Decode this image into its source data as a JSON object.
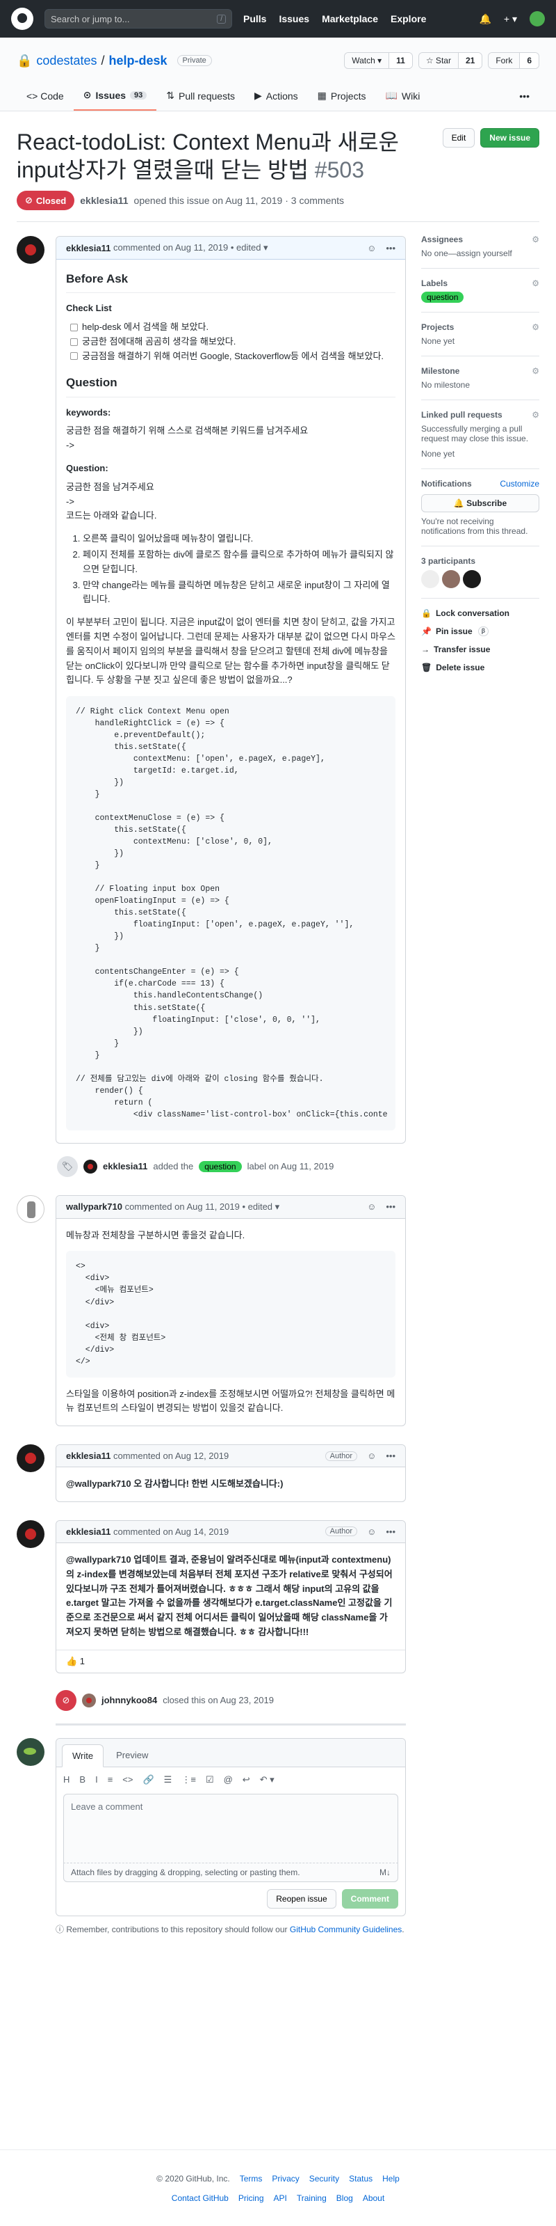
{
  "header": {
    "search_placeholder": "Search or jump to...",
    "slash": "/",
    "nav": [
      "Pulls",
      "Issues",
      "Marketplace",
      "Explore"
    ],
    "plus": "+ ▾"
  },
  "repo": {
    "owner": "codestates",
    "separator": "/",
    "name": "help-desk",
    "visibility": "Private",
    "watch": {
      "label": "Watch ▾",
      "count": "11"
    },
    "star": {
      "label": "☆ Star",
      "count": "21"
    },
    "fork": {
      "label": "Fork",
      "count": "6"
    },
    "tabs": [
      {
        "label": "<> Code"
      },
      {
        "label": "Issues",
        "count": "93"
      },
      {
        "label": "Pull requests"
      },
      {
        "label": "Actions"
      },
      {
        "label": "Projects"
      },
      {
        "label": "Wiki"
      }
    ],
    "more": "•••"
  },
  "issue": {
    "title": "React-todoList: Context Menu과 새로운 input상자가 열렸을때 닫는 방법",
    "number": "#503",
    "edit_label": "Edit",
    "new_issue_label": "New issue",
    "state": "Closed",
    "author": "ekklesia11",
    "meta": "opened this issue on Aug 11, 2019 · 3 comments"
  },
  "comment1": {
    "author": "ekklesia11",
    "meta": "commented on Aug 11, 2019 • edited ▾",
    "h_before": "Before Ask",
    "h_check": "Check List",
    "checks": [
      "help-desk 에서 검색을 해 보았다.",
      "궁금한 점에대해 곰곰히 생각을 해보았다.",
      "궁금점을 해결하기 위해 여러번 Google, Stackoverflow등 에서 검색을 해보았다."
    ],
    "h_question": "Question",
    "h_keywords": "keywords:",
    "kw_text": "궁금한 점을 해결하기 위해 스스로 검색해본 키워드를 남겨주세요",
    "arrow": "->",
    "h_q2": "Question:",
    "q_text1": "궁금한 점을 남겨주세요",
    "q_text2": "코드는 아래와 같습니다.",
    "steps": [
      "오른쪽 클릭이 일어났을때 메뉴창이 열립니다.",
      "페이지 전체를 포함하는 div에 클로즈 함수를 클릭으로 추가하여 메뉴가 클릭되지 않으면 닫힙니다.",
      "만약 change라는 메뉴를 클릭하면 메뉴창은 닫히고 새로운 input창이 그 자리에 열립니다."
    ],
    "para": "이 부분부터 고민이 됩니다. 지금은 input값이 없이 엔터를 치면 창이 닫히고, 값을 가지고 엔터를 치면 수정이 일어납니다. 그런데 문제는 사용자가 대부분 값이 없으면 다시 마우스를 움직이서 페이지 임의의 부분을 클릭해서 창을 닫으려고 할텐데 전체 div에 메뉴창을 닫는 onClick이 있다보니까 만약 클릭으로 닫는 함수를 추가하면 input창을 클릭해도 닫힙니다. 두 상황을 구분 짓고 싶은데 좋은 방법이 없을까요...?",
    "code": "// Right click Context Menu open\n    handleRightClick = (e) => {\n        e.preventDefault();\n        this.setState({\n            contextMenu: ['open', e.pageX, e.pageY],\n            targetId: e.target.id,\n        })\n    }\n\n    contextMenuClose = (e) => {\n        this.setState({\n            contextMenu: ['close', 0, 0],\n        })\n    }\n\n    // Floating input box Open\n    openFloatingInput = (e) => {\n        this.setState({\n            floatingInput: ['open', e.pageX, e.pageY, ''],\n        })\n    }\n\n    contentsChangeEnter = (e) => {\n        if(e.charCode === 13) {\n            this.handleContentsChange()\n            this.setState({\n                floatingInput: ['close', 0, 0, ''],\n            })\n        }\n    }\n\n// 전체를 담고있는 div에 아래와 같이 closing 함수를 줬습니다.\n    render() {\n        return (\n            <div className='list-control-box' onClick={this.conte"
  },
  "label_event": {
    "author": "ekklesia11",
    "pre": "added the",
    "label": "question",
    "post": "label on Aug 11, 2019"
  },
  "comment2": {
    "author": "wallypark710",
    "meta": "commented on Aug 11, 2019 • edited ▾",
    "p1": "메뉴창과 전체창을 구분하시면 좋을것 같습니다.",
    "code": "<>\n  <div>\n    <메뉴 컴포넌트>\n  </div>\n\n  <div>\n    <전체 창 컴포넌트>\n  </div>\n</>",
    "p2": "스타일을 이용하여 position과 z-index를 조정해보시면 어떨까요?! 전체창을 클릭하면 메뉴 컴포넌트의 스타일이 변경되는 방법이 있을것 같습니다."
  },
  "comment3": {
    "author": "ekklesia11",
    "meta": "commented on Aug 12, 2019",
    "badge": "Author",
    "text": "@wallypark710 오 감사합니다! 한번 시도해보겠습니다:)"
  },
  "comment4": {
    "author": "ekklesia11",
    "meta": "commented on Aug 14, 2019",
    "badge": "Author",
    "text": "@wallypark710 업데이트 결과, 준용님이 알려주신대로 메뉴(input과 contextmenu)의 z-index를 변경해보았는데 처음부터 전체 포지션 구조가 relative로 맞춰서 구성되어 있다보니까 구조 전체가 틀어져버렸습니다. ㅎㅎㅎ 그래서 해당 input의 고유의 값을 e.target 말고는 가져올 수 없을까를 생각해보다가 e.target.className인 고정값을 기준으로 조건문으로 써서 같지 전체 어디서든 클릭이 일어났을때 해당 className을 가져오지 못하면 닫히는 방법으로 해결했습니다. ㅎㅎ 감사합니다!!!",
    "reaction": "👍 1"
  },
  "close_event": {
    "author": "johnnykoo84",
    "text": "closed this on Aug 23, 2019"
  },
  "new_comment": {
    "tab_write": "Write",
    "tab_preview": "Preview",
    "tools": [
      "H",
      "B",
      "I",
      "≡",
      "<>",
      "🔗",
      "☰",
      "⋮≡",
      "☑",
      "@",
      "↩",
      "↶ ▾"
    ],
    "placeholder": "Leave a comment",
    "attach": "Attach files by dragging & dropping, selecting or pasting them.",
    "md": "M↓",
    "reopen": "Reopen issue",
    "comment": "Comment",
    "remember_pre": "Remember, contributions to this repository should follow our",
    "remember_link": "GitHub Community Guidelines",
    "remember_post": "."
  },
  "sidebar": {
    "assignees": {
      "title": "Assignees",
      "value": "No one—assign yourself"
    },
    "labels": {
      "title": "Labels",
      "value": "question"
    },
    "projects": {
      "title": "Projects",
      "value": "None yet"
    },
    "milestone": {
      "title": "Milestone",
      "value": "No milestone"
    },
    "linked": {
      "title": "Linked pull requests",
      "desc": "Successfully merging a pull request may close this issue.",
      "value": "None yet"
    },
    "notifications": {
      "title": "Notifications",
      "customize": "Customize",
      "subscribe": "Subscribe",
      "desc": "You're not receiving notifications from this thread."
    },
    "participants": "3 participants",
    "actions": [
      "Lock conversation",
      "Pin issue",
      "Transfer issue",
      "Delete issue"
    ],
    "pin_badge": "β"
  },
  "footer": {
    "row1": [
      "© 2020 GitHub, Inc.",
      "Terms",
      "Privacy",
      "Security",
      "Status",
      "Help"
    ],
    "row2": [
      "Contact GitHub",
      "Pricing",
      "API",
      "Training",
      "Blog",
      "About"
    ]
  },
  "colors": {
    "closed": "#d73a49",
    "green": "#2ea44f",
    "label": "#34d058"
  }
}
